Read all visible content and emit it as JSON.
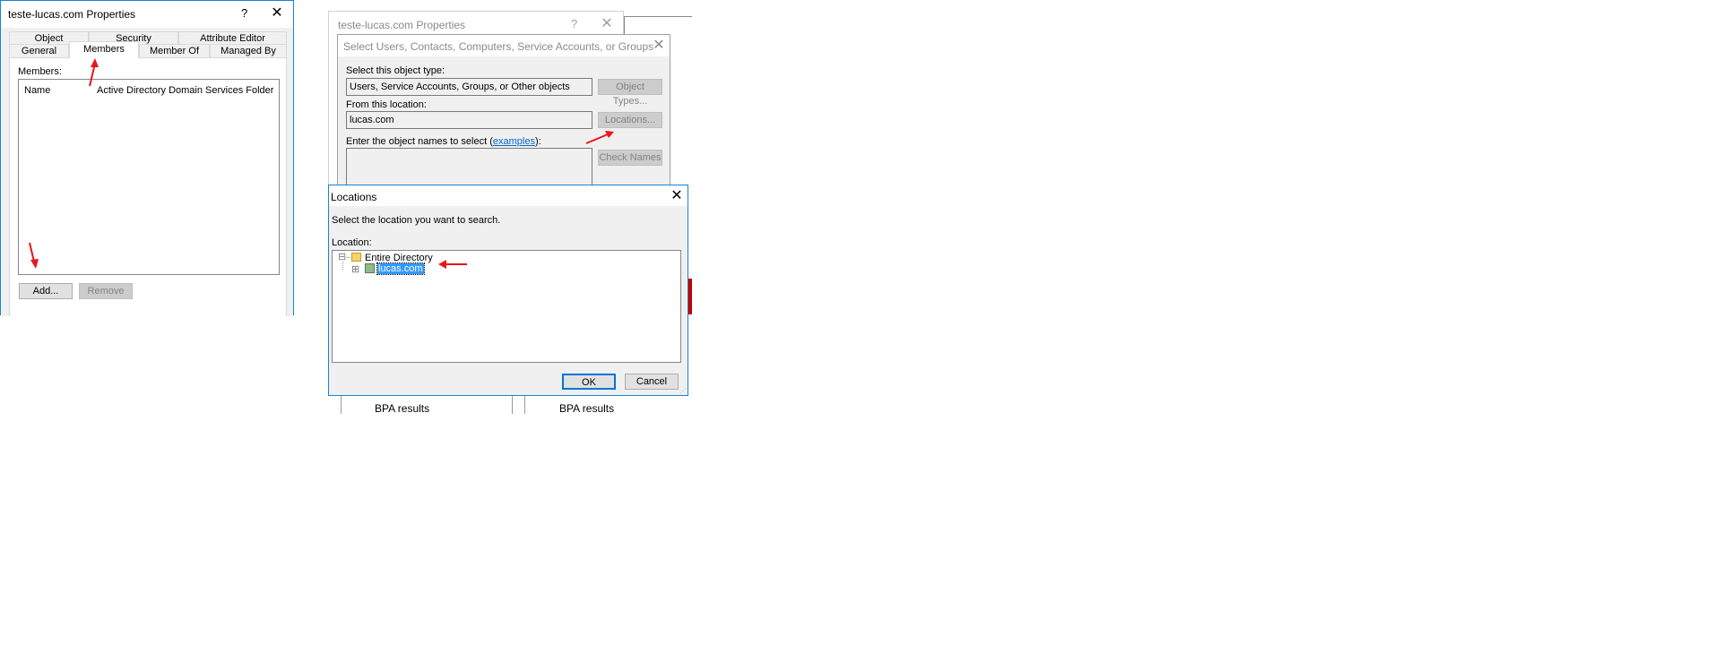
{
  "props_left": {
    "title": "teste-lucas.com Properties",
    "help": "?",
    "close": "✕",
    "tabs_row1": [
      "Object",
      "Security",
      "Attribute Editor"
    ],
    "tabs_row2": [
      "General",
      "Members",
      "Member Of",
      "Managed By"
    ],
    "members_label": "Members:",
    "col_name": "Name",
    "col_folder": "Active Directory Domain Services Folder",
    "add_label": "Add...",
    "remove_label": "Remove"
  },
  "props_back": {
    "title": "teste-lucas.com Properties",
    "help": "?",
    "close": "✕"
  },
  "select_dialog": {
    "title": "Select Users, Contacts, Computers, Service Accounts, or Groups",
    "close": "✕",
    "object_type_label": "Select this object type:",
    "object_type_value": "Users, Service Accounts, Groups, or Other objects",
    "object_types_btn": "Object Types...",
    "location_label": "From this location:",
    "location_value": "lucas.com",
    "locations_btn": "Locations...",
    "names_label_pre": "Enter the object names to select (",
    "names_link": "examples",
    "names_label_post": "):",
    "check_names_btn": "Check Names"
  },
  "locations_dialog": {
    "title": "Locations",
    "close": "✕",
    "instruction": "Select the location you want to search.",
    "location_label": "Location:",
    "tree": {
      "root_toggle": "⊟",
      "root_label": "Entire Directory",
      "child_toggle": "⊞",
      "child_label": "lucas.com"
    },
    "ok_label": "OK",
    "cancel_label": "Cancel"
  },
  "background": {
    "bpa_left": "BPA results",
    "bpa_right": "BPA results"
  },
  "colors": {
    "accent": "#0078d7",
    "arrow": "#e8161b",
    "selection": "#3399ff",
    "link": "#0066cc"
  },
  "icons": [
    "folder-icon",
    "domain-icon",
    "close-icon",
    "help-icon",
    "arrow-annotation"
  ]
}
